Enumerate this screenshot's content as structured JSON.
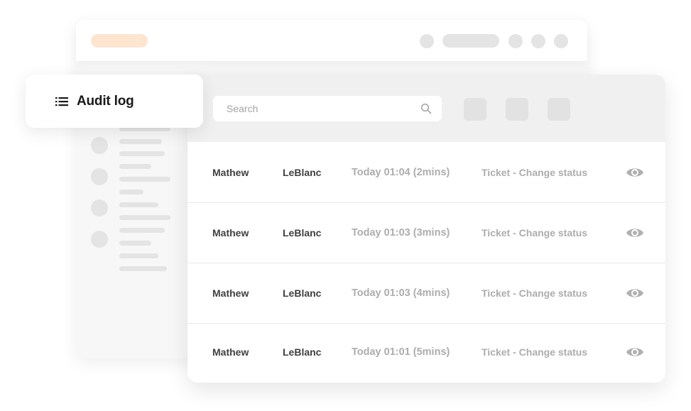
{
  "sidebar": {
    "title": "Audit log",
    "icon": "list-icon"
  },
  "search": {
    "placeholder": "Search",
    "icon": "search-icon"
  },
  "toolbar": {
    "buttons": [
      "toolbar-button-1",
      "toolbar-button-2",
      "toolbar-button-3"
    ]
  },
  "log": {
    "rows": [
      {
        "first": "Mathew",
        "last": "LeBlanc",
        "time": "Today 01:04 (2mins)",
        "action": "Ticket - Change status",
        "icon": "eye-icon"
      },
      {
        "first": "Mathew",
        "last": "LeBlanc",
        "time": "Today 01:03 (3mins)",
        "action": "Ticket - Change status",
        "icon": "eye-icon"
      },
      {
        "first": "Mathew",
        "last": "LeBlanc",
        "time": "Today 01:03 (4mins)",
        "action": "Ticket - Change status",
        "icon": "eye-icon"
      },
      {
        "first": "Mathew",
        "last": "LeBlanc",
        "time": "Today 01:01 (5mins)",
        "action": "Ticket - Change status",
        "icon": "eye-icon"
      }
    ]
  },
  "colors": {
    "accent_placeholder": "#fde5cf",
    "placeholder_gray": "#e4e4e4",
    "header_bg": "#f0f0f0",
    "strong_text": "#404040",
    "muted_text": "#adadad"
  }
}
